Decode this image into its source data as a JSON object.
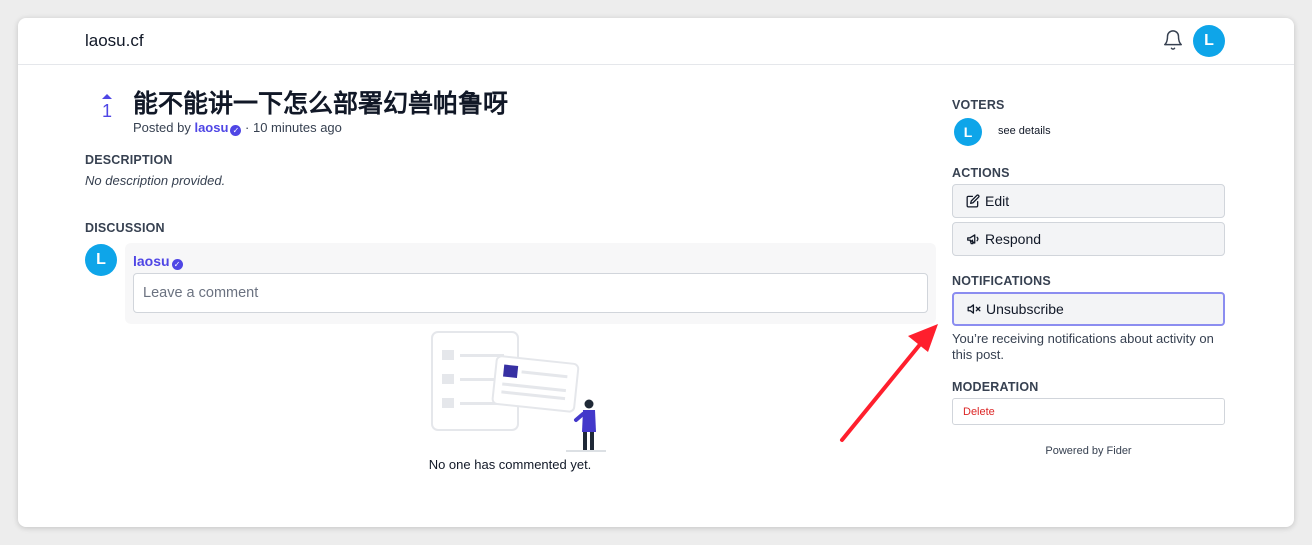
{
  "header": {
    "site_title": "laosu.cf",
    "user_initial": "L"
  },
  "post": {
    "vote_count": "1",
    "title": "能不能讲一下怎么部署幻兽帕鲁呀",
    "posted_by_prefix": "Posted by",
    "author": "laosu",
    "time_ago": "· 10 minutes ago"
  },
  "description": {
    "label": "DESCRIPTION",
    "text": "No description provided."
  },
  "discussion": {
    "label": "DISCUSSION",
    "user_initial": "L",
    "author": "laosu",
    "comment_placeholder": "Leave a comment",
    "empty_text": "No one has commented yet."
  },
  "sidebar": {
    "voters_label": "VOTERS",
    "voter_initial": "L",
    "see_details": "see details",
    "actions_label": "ACTIONS",
    "edit_label": "Edit",
    "respond_label": "Respond",
    "notifications_label": "NOTIFICATIONS",
    "unsubscribe_label": "Unsubscribe",
    "notifications_text": "You’re receiving notifications about activity on this post.",
    "moderation_label": "MODERATION",
    "delete_label": "Delete",
    "powered_by": "Powered by Fider"
  },
  "colors": {
    "accent": "#4f46e5",
    "avatar": "#0ea5e9",
    "annotation_arrow": "#ff1f2d",
    "danger": "#dc2626"
  }
}
